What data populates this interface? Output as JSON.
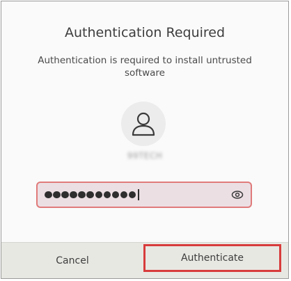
{
  "dialog": {
    "title": "Authentication Required",
    "message": "Authentication is required to install untrusted software",
    "avatar_icon": "user-icon",
    "username": "99TECH",
    "password": {
      "masked_length": 11,
      "reveal_icon": "eye-icon"
    },
    "buttons": {
      "cancel": "Cancel",
      "authenticate": "Authenticate"
    },
    "colors": {
      "field_border": "#e07a7a",
      "field_bg": "#ecdfe4",
      "highlight": "#d83c3c",
      "footer_bg": "#e8e8e3"
    }
  }
}
